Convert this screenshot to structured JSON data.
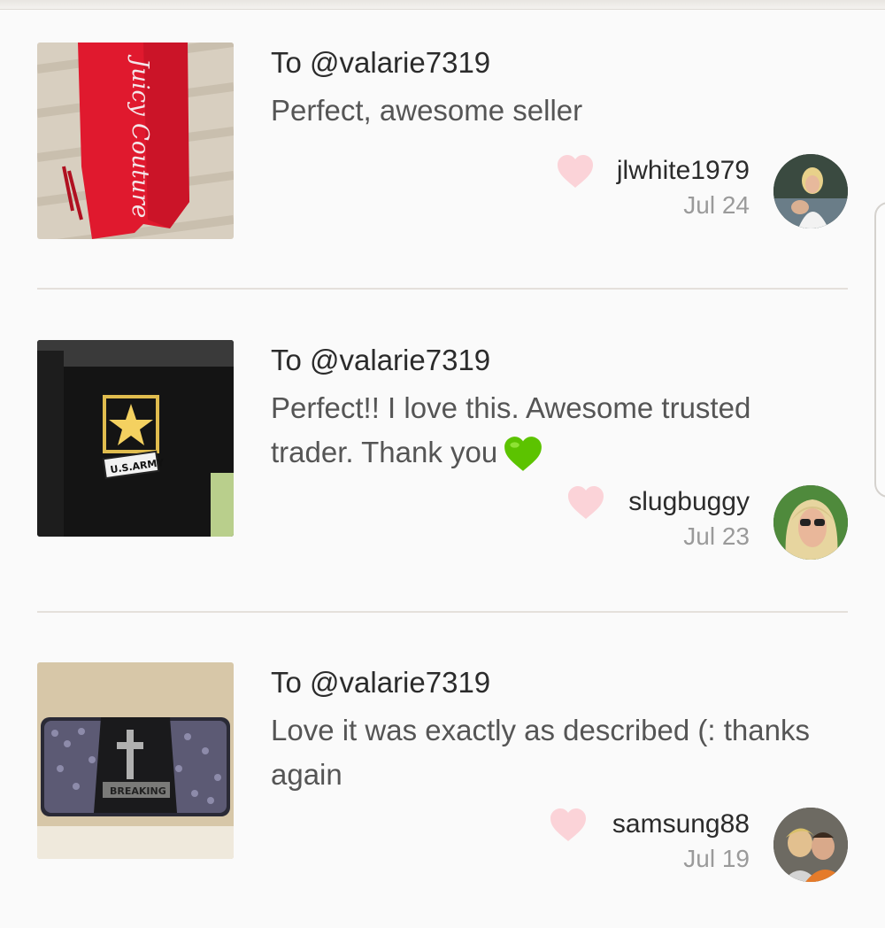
{
  "reviews": [
    {
      "to": "To @valarie7319",
      "comment": "Perfect, awesome seller",
      "username": "jlwhite1979",
      "date": "Jul 24",
      "product_image": "red juicy couture pants",
      "product_text": "Juicy Couture"
    },
    {
      "to": "To @valarie7319",
      "comment": "Perfect!! I love this. Awesome trusted trader. Thank you",
      "emoji": "green-heart-icon",
      "username": "slugbuggy",
      "date": "Jul 23",
      "product_image": "black u.s. army shirt",
      "product_text": "U.S.ARMY"
    },
    {
      "to": "To @valarie7319",
      "comment": "Love it was exactly as described (: thanks again",
      "username": "samsung88",
      "date": "Jul 19",
      "product_image": "sequined wallet with cross",
      "product_text": "BREAKING"
    }
  ],
  "colors": {
    "like_heart": "#fbd3d8",
    "emoji_heart": "#5cc300",
    "divider": "#e4e0db"
  }
}
